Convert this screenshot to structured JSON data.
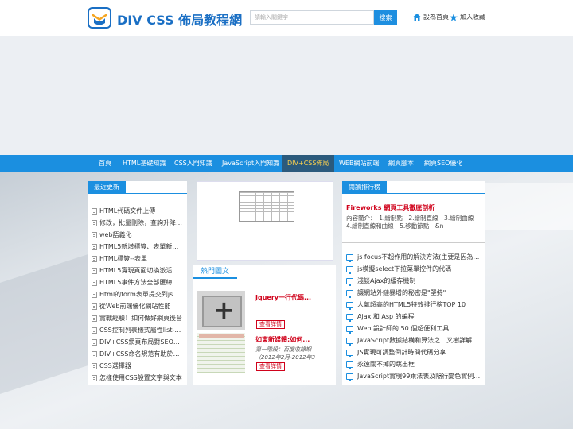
{
  "header": {
    "site_title": "DIV CSS 佈局教程網",
    "search_placeholder": "請輸入關鍵字",
    "search_button": "搜索",
    "set_home": "設為首頁",
    "add_favorite": "加入收藏"
  },
  "nav": {
    "items": [
      "首頁",
      "HTML基礎知識",
      "CSS入門知識",
      "JavaScript入門知識",
      "DIV+CSS佈局",
      "WEB網站前端",
      "網頁腳本",
      "網頁SEO優化"
    ],
    "active_index": 4
  },
  "latest": {
    "title": "最近更新",
    "items": [
      "HTML代碼文件上傳",
      "修改，批量刪除，查詢升降序排",
      "web語義化",
      "HTML5新增標簽、表單新增屬性",
      "HTML標簽--表單",
      "HTML5實現頁面切換激活的功能",
      "HTML5事件方法全部匯總",
      "Html的form表單提交到jsp中文亂碼",
      "從Web前端優化網站性能",
      "實戰經驗！如何做好網頁後台",
      "CSS控制列表樣式屬性list-style",
      "DIV+CSS網頁布局對SEO的影響",
      "DIV+CSS命名規范有助於SEO",
      "CSS選擇器",
      "怎樣使用CSS設置文字與文本"
    ]
  },
  "hot": {
    "title": "熱門圖文",
    "items": [
      {
        "title": "Jquery一行代碼...",
        "desc": "",
        "button": "查看詳情"
      },
      {
        "title": "如東新媒體:如何...",
        "desc": "第一階段：百度收錄期（2012年2月-2012年3",
        "button": "查看詳情"
      }
    ]
  },
  "ranking": {
    "title": "閱讀排行榜",
    "feature_title": "Fireworks 網頁工具徹底剖析",
    "feature_desc": "內容簡介：　1.繪制點　2.繪制直線　3.繪制曲線　4.繪制直線和曲線　5.移動節點　&n",
    "items": [
      "js focus不起作用的解決方法(主要是因為dom元素",
      "js模擬select下拉菜單控件的代碼",
      "淺談Ajax的緩存機制",
      "讓網站外鏈暴增的秘密是\"堅持\"",
      "人氣超高的HTML5特效排行榜TOP 10",
      "Ajax 和 Asp 的編程",
      "Web 設計師的 50 個超便利工具",
      "JavaScript數據結構和算法之二叉樹詳解",
      "JS實現可調整倒計時間代碼分享",
      "永遠關不掉的跳出框",
      "JavaScript實現99乘法表及隔行變色實例代碼"
    ]
  },
  "colors": {
    "accent": "#1b8fe0",
    "brand_title": "#1a6fc4",
    "highlight_red": "#d0021b",
    "nav_active_text": "#ffd34d"
  }
}
